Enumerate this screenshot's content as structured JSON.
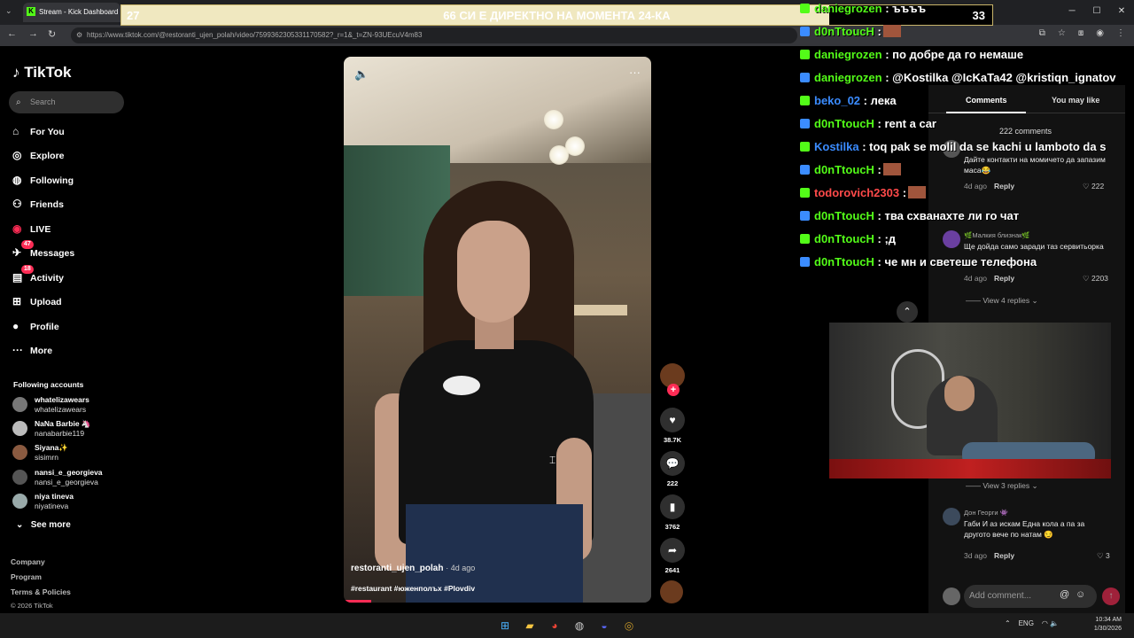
{
  "browser": {
    "tab_title": "Stream - Kick Dashboard",
    "url": "https://www.tiktok.com/@restoranti_ujen_polah/video/7599362305331170582?_r=1&_t=ZN-93UEcuV4m83"
  },
  "banner": {
    "left_number": "27",
    "title": "66 СИ Е ДИРЕКТНО НА МОМЕНТА 24-КА",
    "right_number": "33"
  },
  "tiktok": {
    "logo": "TikTok",
    "search_placeholder": "Search",
    "nav": [
      {
        "label": "For You",
        "icon": "home-icon"
      },
      {
        "label": "Explore",
        "icon": "compass-icon"
      },
      {
        "label": "Following",
        "icon": "following-icon"
      },
      {
        "label": "Friends",
        "icon": "friends-icon"
      },
      {
        "label": "LIVE",
        "icon": "live-icon"
      },
      {
        "label": "Messages",
        "icon": "messages-icon",
        "badge": "47"
      },
      {
        "label": "Activity",
        "icon": "activity-icon",
        "badge": "18"
      },
      {
        "label": "Upload",
        "icon": "upload-icon"
      },
      {
        "label": "Profile",
        "icon": "profile-icon"
      },
      {
        "label": "More",
        "icon": "more-icon"
      }
    ],
    "following_title": "Following accounts",
    "following": [
      {
        "name": "whatelizawears",
        "handle": "whatelizawears"
      },
      {
        "name": "NaNa Barbie 🦄",
        "handle": "nanabarbie119"
      },
      {
        "name": "Siyana✨",
        "handle": "sisimrn"
      },
      {
        "name": "nansi_e_georgieva",
        "handle": "nansi_e_georgieva"
      },
      {
        "name": "niya tineva",
        "handle": "niyatineva"
      }
    ],
    "see_more": "See more",
    "footer": [
      "Company",
      "Program",
      "Terms & Policies",
      "© 2026 TikTok"
    ]
  },
  "video": {
    "author": "restoranti_ujen_polah",
    "ago": "· 4d ago",
    "tags": "#restaurant #юженполъх #Plovdiv",
    "likes": "38.7K",
    "comments": "222",
    "saves": "3762",
    "shares": "2641",
    "progress": 0.09
  },
  "chat": [
    {
      "user": "daniegrozen",
      "msg": ": ъъъъ",
      "color": "#53fc18"
    },
    {
      "user": "d0nTtoucH",
      "msg": ":",
      "color": "#53fc18",
      "emote": true
    },
    {
      "user": "daniegrozen",
      "msg": ": по добре да го немаше",
      "color": "#53fc18"
    },
    {
      "user": "daniegrozen",
      "msg": ": @Kostilka @IcKaTa42 @kristiqn_ignatov",
      "color": "#53fc18"
    },
    {
      "user": "beko_02",
      "msg": ": лека",
      "color": "#3b8cff"
    },
    {
      "user": "d0nTtoucH",
      "msg": ": rent a car",
      "color": "#53fc18"
    },
    {
      "user": "Kostilka",
      "msg": ": toq pak se molil da se kachi u lamboto da s",
      "color": "#3b8cff"
    },
    {
      "user": "d0nTtoucH",
      "msg": ":",
      "color": "#53fc18",
      "emote": true
    },
    {
      "user": "todorovich2303",
      "msg": ":",
      "color": "#ff4a4a",
      "emote": true
    },
    {
      "user": "d0nTtoucH",
      "msg": ": тва схванахте ли го чат",
      "color": "#53fc18"
    },
    {
      "user": "d0nTtoucH",
      "msg": ": ;д",
      "color": "#53fc18"
    },
    {
      "user": "d0nTtoucH",
      "msg": ": че мн и светеше телефона",
      "color": "#53fc18"
    }
  ],
  "comments_panel": {
    "tab_comments": "Comments",
    "tab_you_may_like": "You may like",
    "count": "222 comments",
    "items": [
      {
        "name": "",
        "text": "Дайте контакти на момичето да запазим маса😂",
        "ago": "4d ago",
        "reply": "Reply",
        "likes": "222"
      },
      {
        "name": "🌿Малкия близнак🌿",
        "text": "Ще дойда само заради таз сервитьорка",
        "ago": "4d ago",
        "reply": "Reply",
        "likes": "2203"
      },
      {
        "name": "Дон Георги 👾",
        "text": "Габи И аз искам Една кола а па за другото вече по натам 😏",
        "ago": "3d ago",
        "reply": "Reply",
        "likes": "3"
      }
    ],
    "view_replies_1": "View 4 replies",
    "view_replies_2": "View 3 replies",
    "add_comment": "Add comment..."
  },
  "taskbar": {
    "tray_lang": "ENG",
    "time": "10:34 AM",
    "date": "1/30/2026"
  }
}
